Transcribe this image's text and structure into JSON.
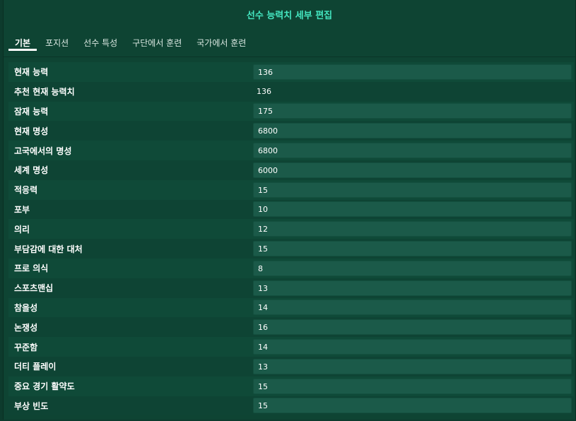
{
  "dialog": {
    "title": "선수 능력치 세부 편집"
  },
  "tabs": [
    {
      "label": "기본",
      "active": true
    },
    {
      "label": "포지션",
      "active": false
    },
    {
      "label": "선수 특성",
      "active": false
    },
    {
      "label": "구단에서 훈련",
      "active": false
    },
    {
      "label": "국가에서 훈련",
      "active": false
    }
  ],
  "rows": [
    {
      "label": "현재 능력",
      "value": "136",
      "editable": true
    },
    {
      "label": "추천 현재 능력치",
      "value": "136",
      "editable": false
    },
    {
      "label": "잠재 능력",
      "value": "175",
      "editable": true
    },
    {
      "label": "현재 명성",
      "value": "6800",
      "editable": true
    },
    {
      "label": "고국에서의 명성",
      "value": "6800",
      "editable": true
    },
    {
      "label": "세계 명성",
      "value": "6000",
      "editable": true
    },
    {
      "label": "적응력",
      "value": "15",
      "editable": true
    },
    {
      "label": "포부",
      "value": "10",
      "editable": true
    },
    {
      "label": "의리",
      "value": "12",
      "editable": true
    },
    {
      "label": "부담감에 대한 대처",
      "value": "15",
      "editable": true
    },
    {
      "label": "프로 의식",
      "value": "8",
      "editable": true
    },
    {
      "label": "스포츠맨십",
      "value": "13",
      "editable": true
    },
    {
      "label": "참을성",
      "value": "14",
      "editable": true
    },
    {
      "label": "논쟁성",
      "value": "16",
      "editable": true
    },
    {
      "label": "꾸준함",
      "value": "14",
      "editable": true
    },
    {
      "label": "더티 플레이",
      "value": "13",
      "editable": true
    },
    {
      "label": "중요 경기 활약도",
      "value": "15",
      "editable": true
    },
    {
      "label": "부상 빈도",
      "value": "15",
      "editable": true
    }
  ]
}
